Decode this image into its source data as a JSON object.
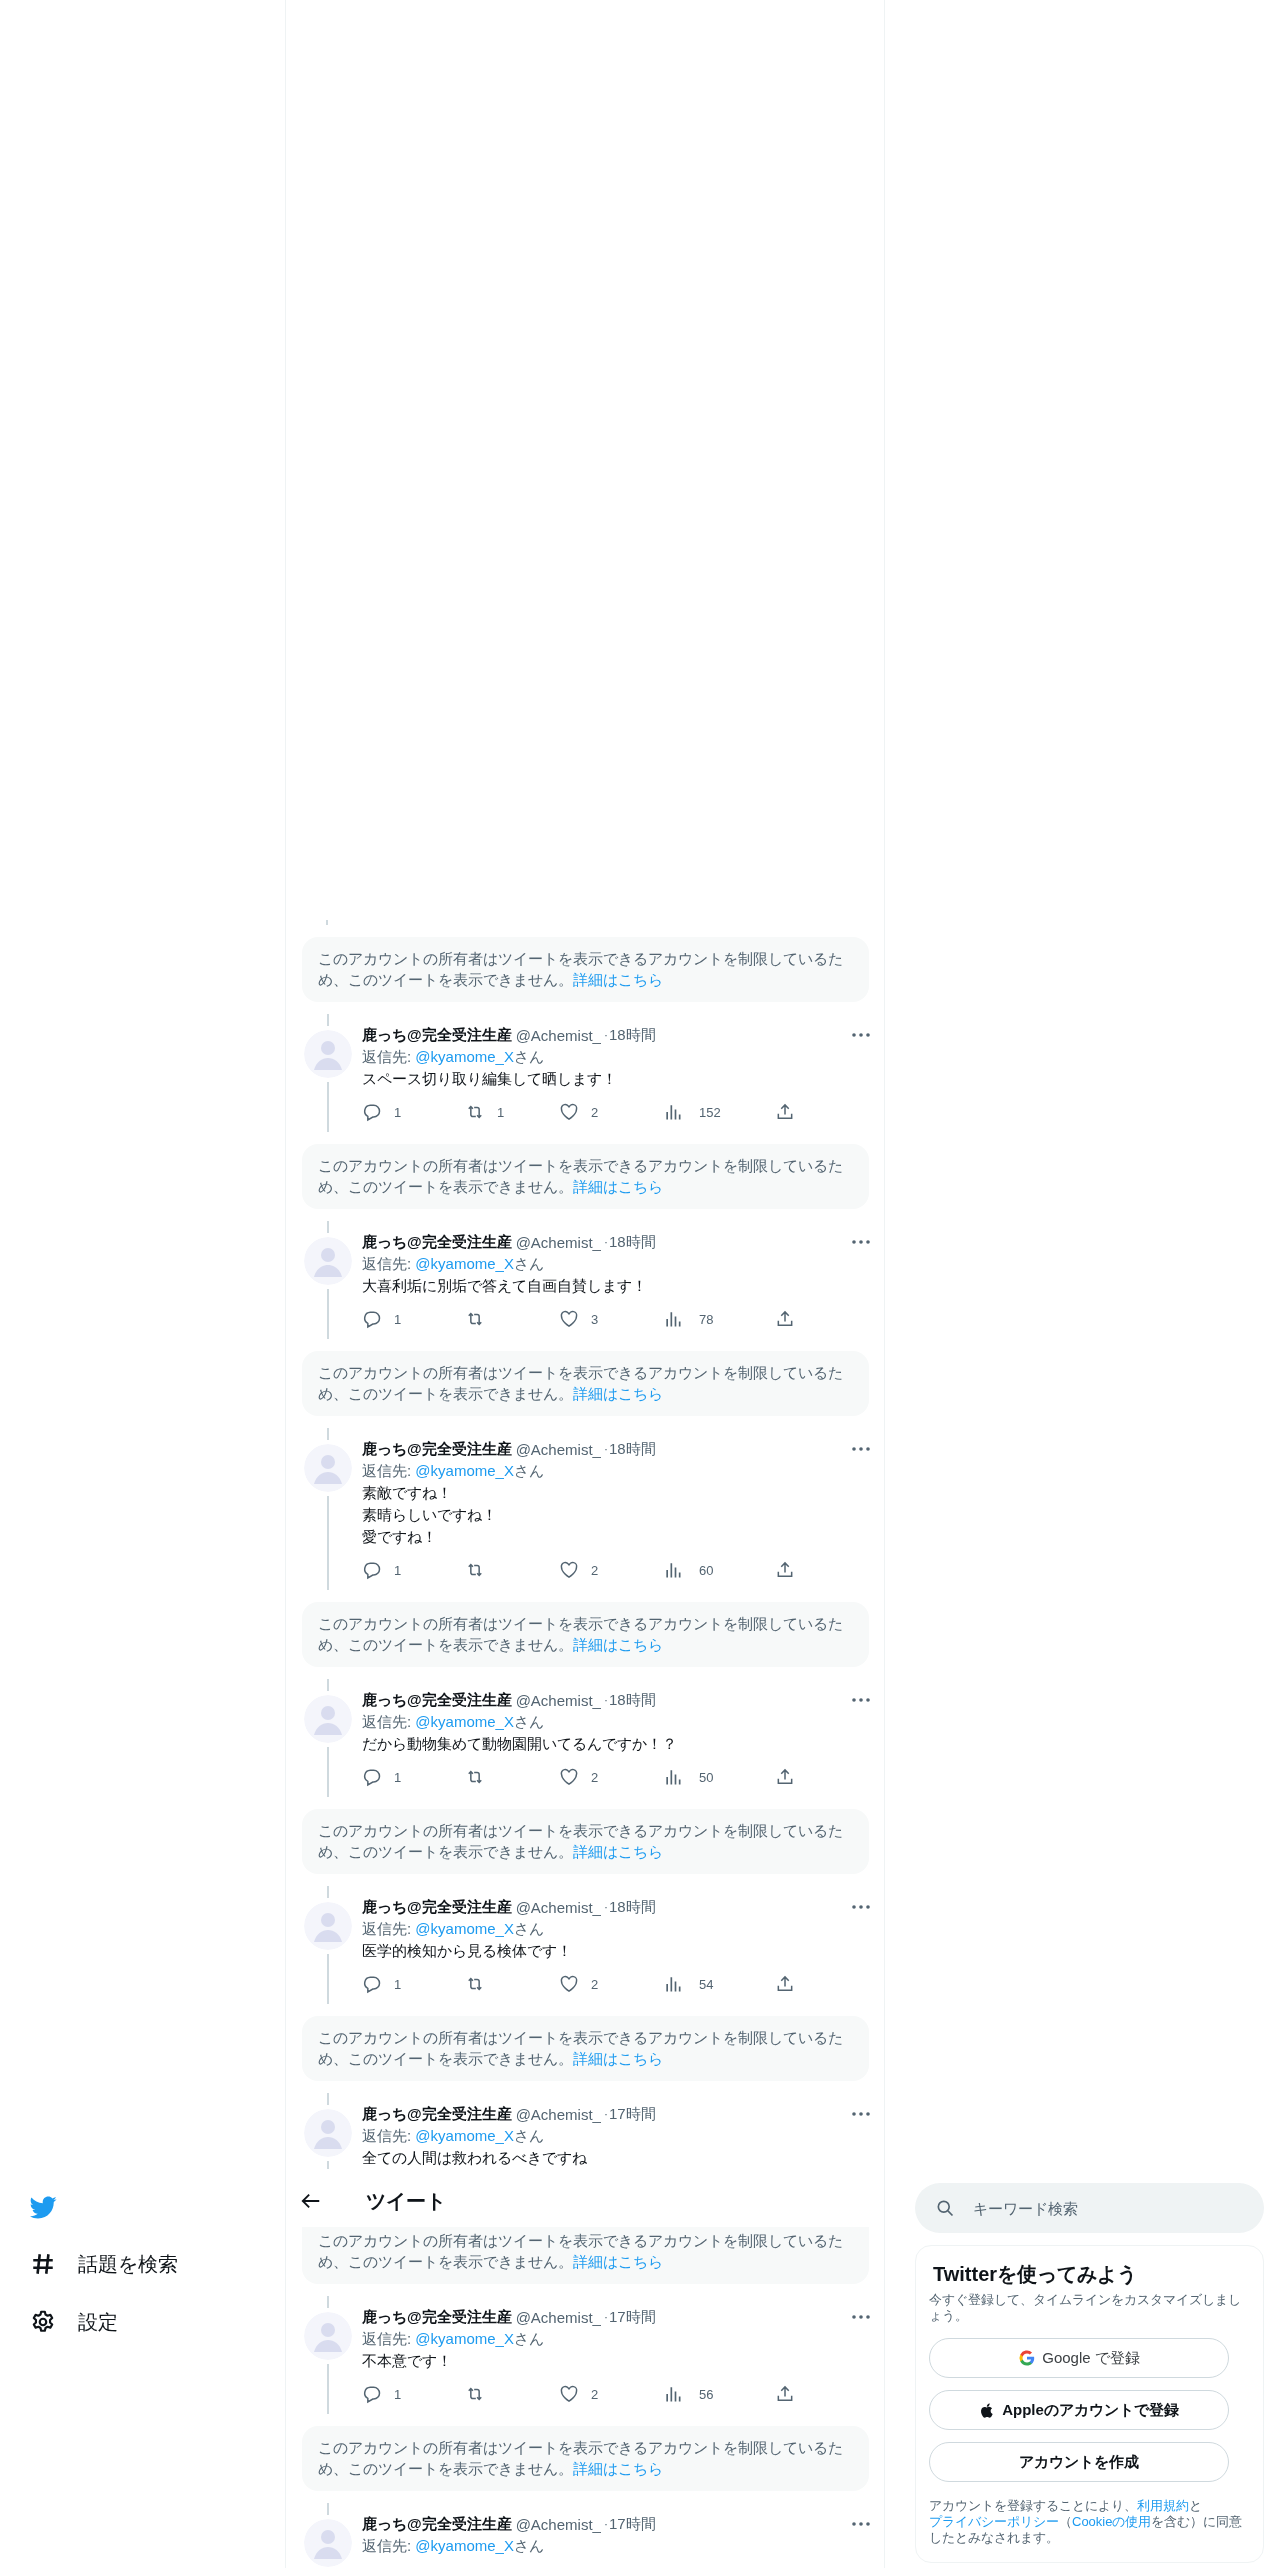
{
  "sidebar": {
    "items": [
      {
        "kind": "hash",
        "label": "話題を検索"
      },
      {
        "kind": "gear",
        "label": "設定"
      }
    ]
  },
  "feed": [
    {
      "kind": "notice",
      "text": "このアカウントの所有者はツイートを表示できるアカウントを制限しているため、このツイートを表示できません。",
      "link": "詳細はこちら"
    },
    {
      "kind": "tweet",
      "name": "鹿っち@完全受注生産",
      "handle": "@Achemist_",
      "dot": "·",
      "time": "18時間",
      "reply_prefix": "返信先: ",
      "mention": "@kyamome_X",
      "reply_suffix": "さん",
      "text": [
        "スペース切り取り編集して晒します！"
      ],
      "actions": {
        "replies": "1",
        "retweets": "1",
        "likes": "2",
        "views": "152"
      }
    },
    {
      "kind": "notice",
      "text": "このアカウントの所有者はツイートを表示できるアカウントを制限しているため、このツイートを表示できません。",
      "link": "詳細はこちら"
    },
    {
      "kind": "tweet",
      "name": "鹿っち@完全受注生産",
      "handle": "@Achemist_",
      "dot": "·",
      "time": "18時間",
      "reply_prefix": "返信先: ",
      "mention": "@kyamome_X",
      "reply_suffix": "さん",
      "text": [
        "大喜利垢に別垢で答えて自画自賛します！"
      ],
      "actions": {
        "replies": "1",
        "likes": "3",
        "views": "78"
      }
    },
    {
      "kind": "notice",
      "text": "このアカウントの所有者はツイートを表示できるアカウントを制限しているため、このツイートを表示できません。",
      "link": "詳細はこちら"
    },
    {
      "kind": "tweet",
      "name": "鹿っち@完全受注生産",
      "handle": "@Achemist_",
      "dot": "·",
      "time": "18時間",
      "reply_prefix": "返信先: ",
      "mention": "@kyamome_X",
      "reply_suffix": "さん",
      "text": [
        "素敵ですね！",
        "素晴らしいですね！",
        "愛ですね！"
      ],
      "actions": {
        "replies": "1",
        "likes": "2",
        "views": "60"
      }
    },
    {
      "kind": "notice",
      "text": "このアカウントの所有者はツイートを表示できるアカウントを制限しているため、このツイートを表示できません。",
      "link": "詳細はこちら"
    },
    {
      "kind": "tweet",
      "name": "鹿っち@完全受注生産",
      "handle": "@Achemist_",
      "dot": "·",
      "time": "18時間",
      "reply_prefix": "返信先: ",
      "mention": "@kyamome_X",
      "reply_suffix": "さん",
      "text": [
        "だから動物集めて動物園開いてるんですか！？"
      ],
      "actions": {
        "replies": "1",
        "likes": "2",
        "views": "50"
      }
    },
    {
      "kind": "notice",
      "text": "このアカウントの所有者はツイートを表示できるアカウントを制限しているため、このツイートを表示できません。",
      "link": "詳細はこちら"
    },
    {
      "kind": "tweet",
      "name": "鹿っち@完全受注生産",
      "handle": "@Achemist_",
      "dot": "·",
      "time": "18時間",
      "reply_prefix": "返信先: ",
      "mention": "@kyamome_X",
      "reply_suffix": "さん",
      "text": [
        "医学的検知から見る検体です！"
      ],
      "actions": {
        "replies": "1",
        "likes": "2",
        "views": "54"
      }
    },
    {
      "kind": "notice",
      "text": "このアカウントの所有者はツイートを表示できるアカウントを制限しているため、このツイートを表示できません。",
      "link": "詳細はこちら"
    },
    {
      "kind": "tweet",
      "name": "鹿っち@完全受注生産",
      "handle": "@Achemist_",
      "dot": "·",
      "time": "17時間",
      "reply_prefix": "返信先: ",
      "mention": "@kyamome_X",
      "reply_suffix": "さん",
      "text": [
        "全ての人間は救われるべきですね"
      ]
    },
    {
      "kind": "header",
      "title": "ツイート"
    },
    {
      "kind": "notice",
      "text": "このアカウントの所有者はツイートを表示できるアカウントを制限しているため、このツイートを表示できません。",
      "link": "詳細はこちら"
    },
    {
      "kind": "tweet",
      "name": "鹿っち@完全受注生産",
      "handle": "@Achemist_",
      "dot": "·",
      "time": "17時間",
      "reply_prefix": "返信先: ",
      "mention": "@kyamome_X",
      "reply_suffix": "さん",
      "text": [
        "不本意です！"
      ],
      "actions": {
        "replies": "1",
        "likes": "2",
        "views": "56"
      }
    },
    {
      "kind": "notice",
      "text": "このアカウントの所有者はツイートを表示できるアカウントを制限しているため、このツイートを表示できません。",
      "link": "詳細はこちら"
    },
    {
      "kind": "tweet",
      "name": "鹿っち@完全受注生産",
      "handle": "@Achemist_",
      "dot": "·",
      "time": "17時間",
      "reply_prefix": "返信先: ",
      "mention": "@kyamome_X",
      "reply_suffix": "さん"
    }
  ],
  "search": {
    "placeholder": "キーワード検索"
  },
  "signup": {
    "title": "Twitterを使ってみよう",
    "subtitle": "今すぐ登録して、タイムラインをカスタマイズしましょう。",
    "buttons": [
      {
        "kind": "google",
        "label": "Google で登録"
      },
      {
        "kind": "apple",
        "label": "Appleのアカウントで登録"
      },
      {
        "kind": "create",
        "label": "アカウントを作成"
      }
    ],
    "terms": [
      {
        "kind": "text",
        "text": "アカウントを登録することにより、"
      },
      {
        "kind": "link",
        "text": "利用規約"
      },
      {
        "kind": "text",
        "text": "と"
      },
      {
        "kind": "link",
        "text": "プライバシーポリシー"
      },
      {
        "kind": "text",
        "text": "（"
      },
      {
        "kind": "link",
        "text": "Cookieの使用"
      },
      {
        "kind": "text",
        "text": "を含む）に同意したとみなされます。"
      }
    ]
  }
}
